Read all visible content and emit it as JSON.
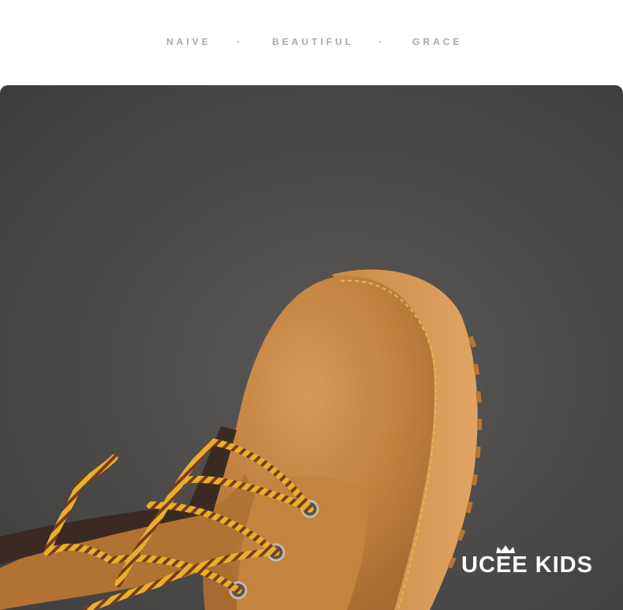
{
  "header": {
    "words": [
      "NAIVE",
      "BEAUTIFUL",
      "GRACE"
    ],
    "separator": "·"
  },
  "photo": {
    "subject": "boot-photo"
  },
  "brand": {
    "name": "UCEE KIDS"
  },
  "colors": {
    "background": "#ffffff",
    "tagline": "#a8a8a8",
    "photo_bg": "#4a4948",
    "boot_leather": "#c98a45",
    "sole": "#d89a55",
    "lace_yellow": "#e8b12a",
    "lace_brown": "#7a3b1e",
    "brand_text": "#ffffff"
  }
}
